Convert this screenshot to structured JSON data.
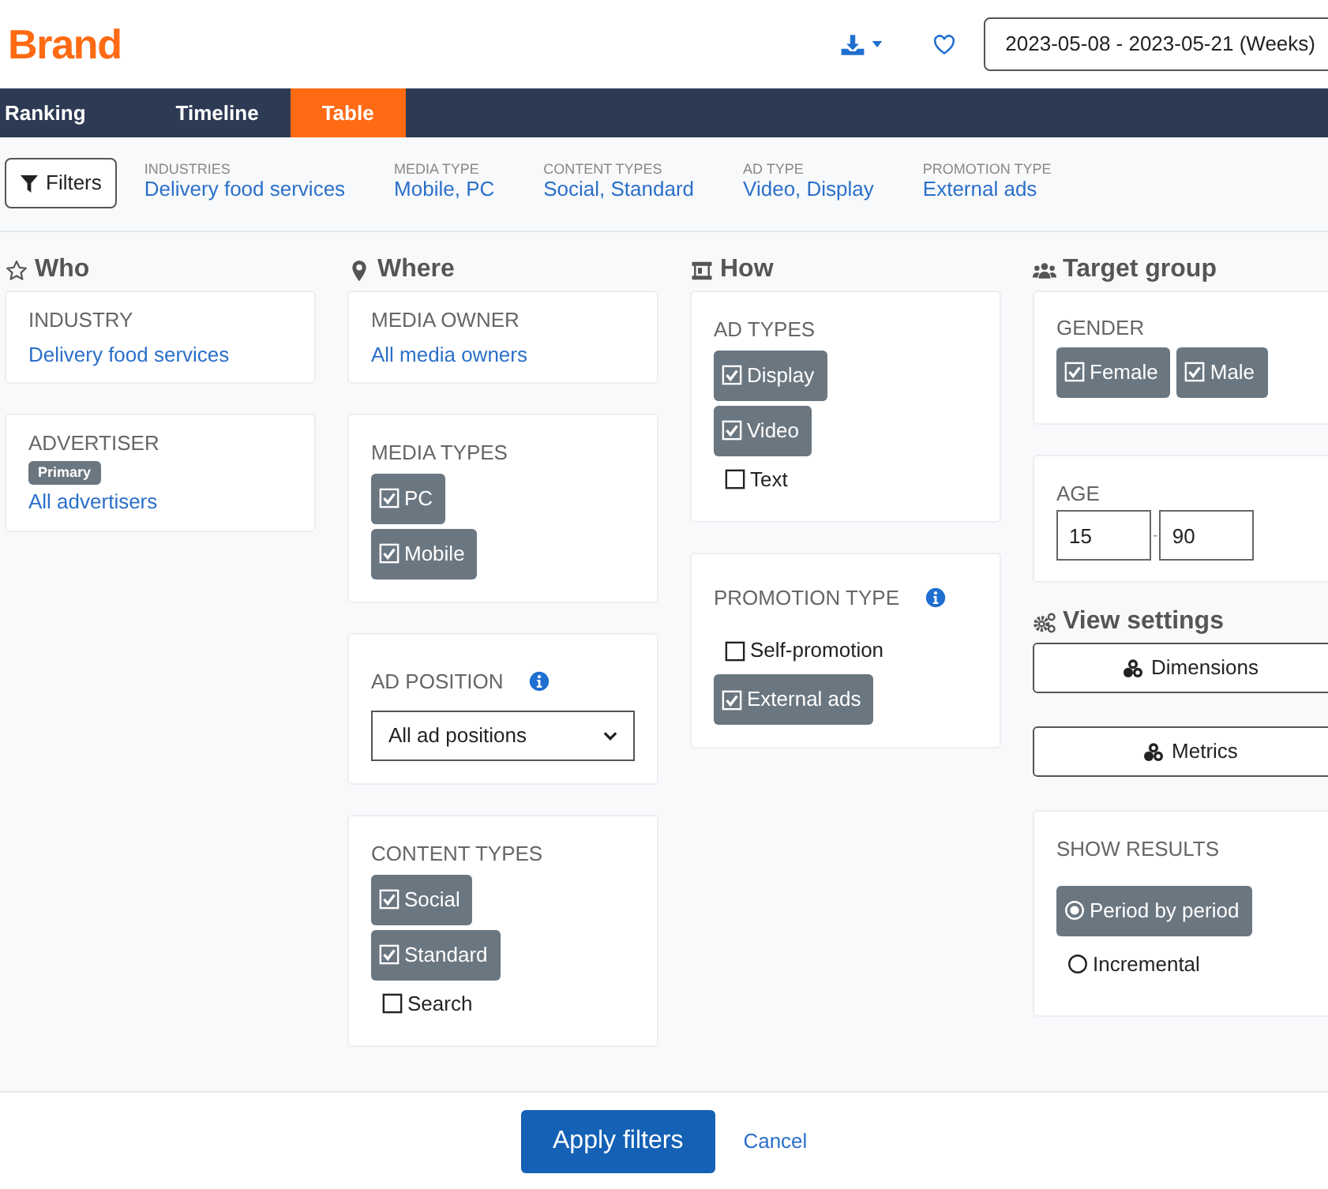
{
  "brand": "Brand",
  "date_range": "2023-05-08 - 2023-05-21 (Weeks)",
  "tabs": [
    {
      "label": "Ranking",
      "selected": false
    },
    {
      "label": "Timeline",
      "selected": false
    },
    {
      "label": "Table",
      "selected": true
    }
  ],
  "filters_button": "Filters",
  "summary": [
    {
      "label": "INDUSTRIES",
      "value": "Delivery food services"
    },
    {
      "label": "MEDIA TYPE",
      "value": "Mobile, PC"
    },
    {
      "label": "CONTENT TYPES",
      "value": "Social, Standard"
    },
    {
      "label": "AD TYPE",
      "value": "Video, Display"
    },
    {
      "label": "PROMOTION TYPE",
      "value": "External ads"
    }
  ],
  "columns": [
    {
      "blocks": [
        {
          "kind": "heading",
          "title": "Who"
        },
        {
          "kind": "link",
          "label": "INDUSTRY",
          "value": "Delivery food services"
        },
        {
          "kind": "advertiser",
          "label": "ADVERTISER",
          "badge": "Primary",
          "value": "All advertisers"
        }
      ]
    },
    {
      "blocks": [
        {
          "kind": "heading",
          "title": "Where"
        },
        {
          "kind": "link",
          "label": "MEDIA OWNER",
          "value": "All media owners"
        },
        {
          "kind": "checks",
          "label": "MEDIA TYPES",
          "info": false,
          "options": [
            {
              "label": "PC",
              "checked": true
            },
            {
              "label": "Mobile",
              "checked": true
            }
          ]
        },
        {
          "kind": "select",
          "label": "AD POSITION",
          "info": true,
          "value": "All ad positions"
        },
        {
          "kind": "checks",
          "label": "CONTENT TYPES",
          "info": false,
          "options": [
            {
              "label": "Social",
              "checked": true
            },
            {
              "label": "Standard",
              "checked": true
            },
            {
              "label": "Search",
              "checked": false
            }
          ]
        }
      ]
    },
    {
      "blocks": [
        {
          "kind": "heading",
          "title": "How"
        },
        {
          "kind": "checks",
          "label": "AD TYPES",
          "info": false,
          "options": [
            {
              "label": "Display",
              "checked": true
            },
            {
              "label": "Video",
              "checked": true
            },
            {
              "label": "Text",
              "checked": false
            }
          ]
        },
        {
          "kind": "checks",
          "label": "PROMOTION TYPE",
          "info": true,
          "options": [
            {
              "label": "Self-promotion",
              "checked": false
            },
            {
              "label": "External ads",
              "checked": true
            }
          ]
        }
      ]
    },
    {
      "blocks": [
        {
          "kind": "heading",
          "title": "Target group"
        },
        {
          "kind": "inline_checks",
          "label": "GENDER",
          "options": [
            {
              "label": "Female",
              "checked": true
            },
            {
              "label": "Male",
              "checked": true
            }
          ]
        },
        {
          "kind": "age",
          "label": "AGE",
          "from": "15",
          "separator": "-",
          "to": "90"
        },
        {
          "kind": "heading",
          "title": "View settings"
        },
        {
          "kind": "button",
          "label": "Dimensions"
        },
        {
          "kind": "button",
          "label": "Metrics"
        },
        {
          "kind": "radios",
          "label": "SHOW RESULTS",
          "options": [
            {
              "label": "Period by period",
              "selected": true
            },
            {
              "label": "Incremental",
              "selected": false
            }
          ]
        }
      ]
    }
  ],
  "apply_button": "Apply filters",
  "cancel_link": "Cancel"
}
